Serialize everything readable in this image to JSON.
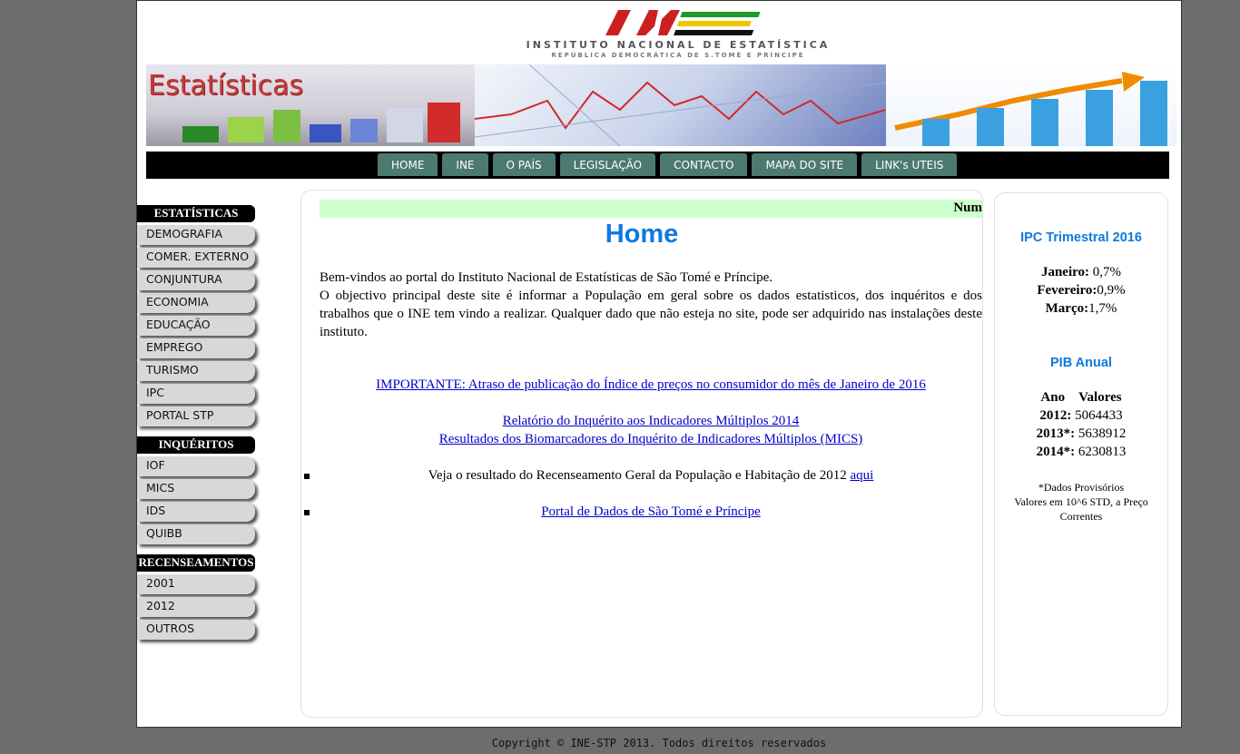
{
  "header": {
    "logo_mark": "INE",
    "logo_line1": "INSTITUTO NACIONAL DE ESTATÍSTICA",
    "logo_line2": "REPÚBLICA DEMOCRÁTICA DE S.TOMÉ E PRÍNCIPE",
    "banner_title": "Estatísticas"
  },
  "nav": [
    "HOME",
    "INE",
    "O PAÍS",
    "LEGISLAÇÃO",
    "CONTACTO",
    "MAPA DO SITE",
    "LINK's UTEIS"
  ],
  "sidebar": {
    "estatisticas_title": "ESTATÍSTICAS",
    "estatisticas": [
      "DEMOGRAFIA",
      "COMER. EXTERNO",
      "CONJUNTURA",
      "ECONOMIA",
      "EDUCAÇÃO",
      "EMPREGO",
      "TURISMO",
      "IPC",
      "PORTAL STP"
    ],
    "inqueritos_title": "INQUÉRITOS",
    "inqueritos": [
      "IOF",
      "MICS",
      "IDS",
      "QUIBB"
    ],
    "recenseamentos_title": "RECENSEAMENTOS",
    "recenseamentos": [
      "2001",
      "2012",
      "OUTROS"
    ]
  },
  "main": {
    "marquee": "Num",
    "title": "Home",
    "intro_1": "Bem-vindos ao portal do Instituto Nacional de Estatísticas de São Tomé e Príncipe.",
    "intro_2": "O objectivo principal deste site é informar a População em geral sobre os dados estatisticos, dos inquéritos e dos trabalhos que o INE tem vindo a realizar. Qualquer dado que não esteja no site, pode ser adquirido nas instalações deste instituto.",
    "link_important": "IMPORTANTE: Atraso de publicação do Índice de preços no consumidor do mês de Janeiro de 2016",
    "link_mics_report": "Relatório do Inquérito aos Indicadores Múltiplos 2014",
    "link_mics_bio": "Resultados dos Biomarcadores do Inquérito de Indicadores Múltiplos (MICS)",
    "census_text": "Veja o resultado do Recenseamento Geral da População e Habitação de 2012",
    "census_link": "aqui",
    "portal_link": "Portal de Dados de São Tomé e Príncipe"
  },
  "right": {
    "ipc_title": "IPC Trimestral 2016",
    "ipc": [
      {
        "label": "Janeiro:",
        "value": " 0,7%"
      },
      {
        "label": "Fevereiro:",
        "value": "0,9%"
      },
      {
        "label": "Março:",
        "value": "1,7%"
      }
    ],
    "pib_title": "PIB Anual",
    "pib_header_ano": "Ano",
    "pib_header_valores": "Valores",
    "pib": [
      {
        "label": "2012:",
        "value": " 5064433"
      },
      {
        "label": "2013*:",
        "value": " 5638912"
      },
      {
        "label": "2014*:",
        "value": " 6230813"
      }
    ],
    "note_1": "*Dados Provisórios",
    "note_2": "Valores em 10^6 STD, a Preço Correntes"
  },
  "footer": "Copyright © INE-STP 2013. Todos direitos reservados"
}
